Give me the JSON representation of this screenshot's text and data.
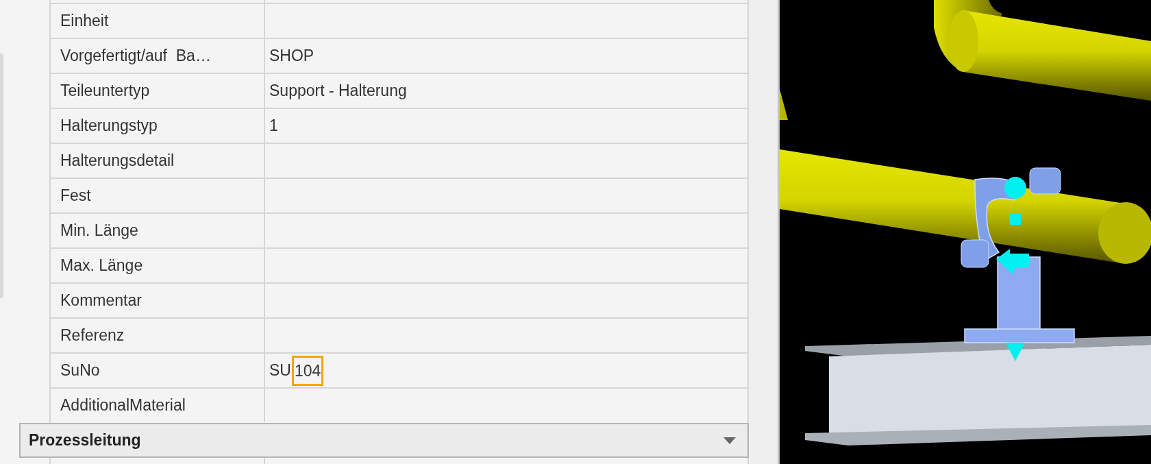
{
  "properties": {
    "rows": [
      {
        "label": "Einheit"
      },
      {
        "label": "Vorgefertigt/auf  Ba…",
        "value": "SHOP"
      },
      {
        "label": "Teileuntertyp",
        "value": "Support - Halterung"
      },
      {
        "label": "Halterungstyp",
        "value": "1"
      },
      {
        "label": "Halterungsdetail"
      },
      {
        "label": "Fest"
      },
      {
        "label": "Min. Länge"
      },
      {
        "label": "Max. Länge"
      },
      {
        "label": "Kommentar"
      },
      {
        "label": "Referenz"
      },
      {
        "label": "SuNo",
        "value": "SU",
        "highlight": "104"
      },
      {
        "label": "AdditionalMaterial"
      }
    ]
  },
  "section": {
    "title": "Prozessleitung",
    "expanded": true
  }
}
